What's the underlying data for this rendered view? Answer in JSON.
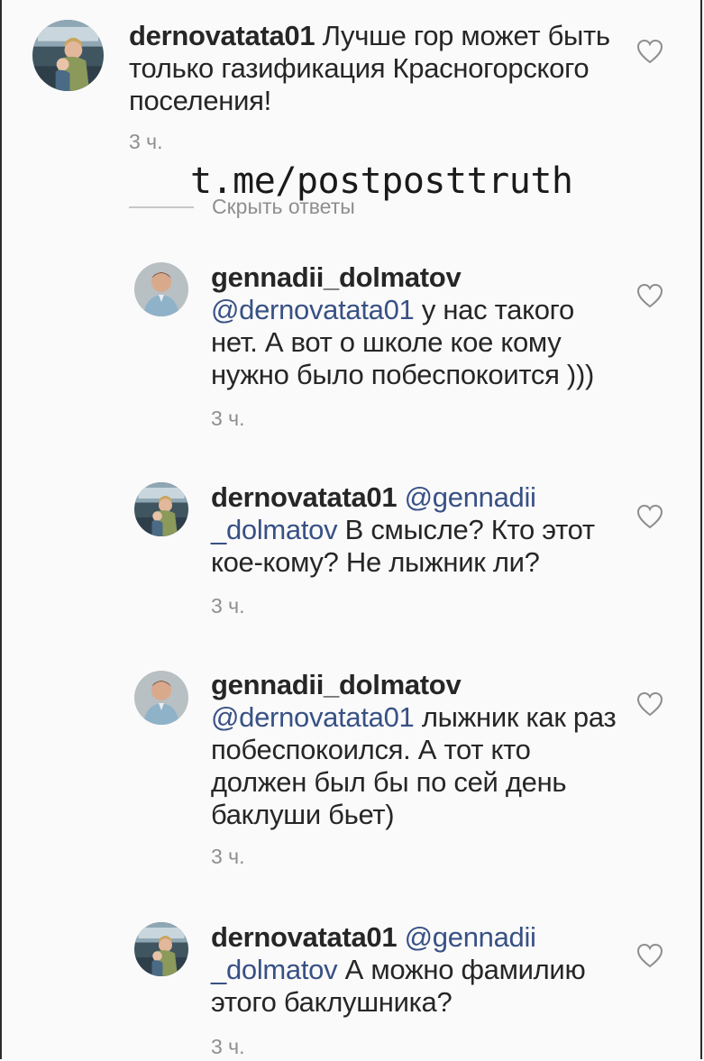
{
  "watermark": "t.me/postposttruth",
  "hide_replies_label": "Скрыть ответы",
  "comments": [
    {
      "username": "dernovatata01",
      "mention": "",
      "text": "Лучше гор может быть только газификация Красногорского поселения!",
      "time": "3 ч.",
      "avatar_icon": "avatar-woman-child-photo",
      "like_icon": "heart-outline-icon"
    },
    {
      "username": "gennadii_dolmatov",
      "mention": "@dernovatata01",
      "text": "у нас такого нет. А вот о школе кое кому нужно было побеспокоится )))",
      "time": "3 ч.",
      "avatar_icon": "avatar-man-photo",
      "like_icon": "heart-outline-icon"
    },
    {
      "username": "dernovatata01",
      "mention": "@gennadii _dolmatov",
      "text": "В смысле? Кто этот кое-кому? Не лыжник ли?",
      "time": "3 ч.",
      "avatar_icon": "avatar-woman-child-photo",
      "like_icon": "heart-outline-icon"
    },
    {
      "username": "gennadii_dolmatov",
      "mention": "@dernovatata01",
      "text": "лыжник как раз побеспокоился. А тот кто должен был бы по сей день баклуши бьет)",
      "time": "3 ч.",
      "avatar_icon": "avatar-man-photo",
      "like_icon": "heart-outline-icon"
    },
    {
      "username": "dernovatata01",
      "mention": "@gennadii _dolmatov",
      "text": "А можно фамилию этого баклушника?",
      "time": "3 ч.",
      "avatar_icon": "avatar-woman-child-photo",
      "like_icon": "heart-outline-icon"
    }
  ],
  "colors": {
    "background": "#fafafa",
    "text": "#262626",
    "mention": "#385185",
    "meta": "#8e8e8e"
  }
}
